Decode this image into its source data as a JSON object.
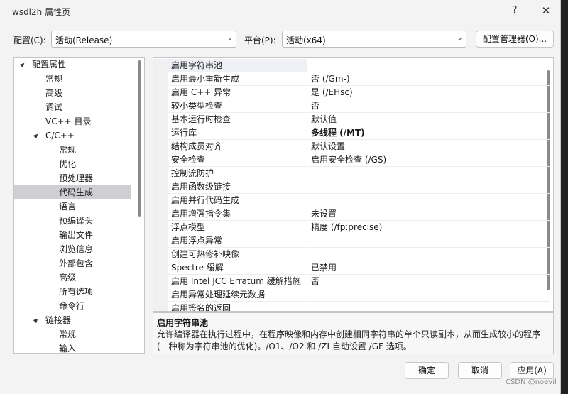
{
  "window": {
    "title": "wsdl2h 属性页",
    "help": "?",
    "close": "✕"
  },
  "top": {
    "config_label": "配置(C):",
    "config_value": "活动(Release)",
    "platform_label": "平台(P):",
    "platform_value": "活动(x64)",
    "manager_button": "配置管理器(O)..."
  },
  "tree": [
    {
      "label": "配置属性",
      "expander": "▲"
    },
    {
      "label": "常规"
    },
    {
      "label": "高级"
    },
    {
      "label": "调试"
    },
    {
      "label": "VC++ 目录"
    },
    {
      "label": "C/C++",
      "expander": "▲"
    },
    {
      "label": "常规"
    },
    {
      "label": "优化"
    },
    {
      "label": "预处理器"
    },
    {
      "label": "代码生成",
      "selected": true
    },
    {
      "label": "语言"
    },
    {
      "label": "预编译头"
    },
    {
      "label": "输出文件"
    },
    {
      "label": "浏览信息"
    },
    {
      "label": "外部包含"
    },
    {
      "label": "高级"
    },
    {
      "label": "所有选项"
    },
    {
      "label": "命令行"
    },
    {
      "label": "链接器",
      "expander": "▲"
    },
    {
      "label": "常规"
    },
    {
      "label": "输入"
    }
  ],
  "properties": [
    {
      "name": "启用字符串池",
      "value": "",
      "selected": true
    },
    {
      "name": "启用最小重新生成",
      "value": "否 (/Gm-)"
    },
    {
      "name": "启用 C++ 异常",
      "value": "是 (/EHsc)"
    },
    {
      "name": "较小类型检查",
      "value": "否"
    },
    {
      "name": "基本运行时检查",
      "value": "默认值"
    },
    {
      "name": "运行库",
      "value": "多线程 (/MT)",
      "bold": true
    },
    {
      "name": "结构成员对齐",
      "value": "默认设置"
    },
    {
      "name": "安全检查",
      "value": "启用安全检查 (/GS)"
    },
    {
      "name": "控制流防护",
      "value": ""
    },
    {
      "name": "启用函数级链接",
      "value": ""
    },
    {
      "name": "启用并行代码生成",
      "value": ""
    },
    {
      "name": "启用增强指令集",
      "value": "未设置"
    },
    {
      "name": "浮点模型",
      "value": "精度 (/fp:precise)"
    },
    {
      "name": "启用浮点异常",
      "value": ""
    },
    {
      "name": "创建可热修补映像",
      "value": ""
    },
    {
      "name": "Spectre 缓解",
      "value": "已禁用"
    },
    {
      "name": "启用 Intel JCC Erratum 缓解措施",
      "value": "否"
    },
    {
      "name": "启用异常处理延续元数据",
      "value": ""
    },
    {
      "name": "启用签名的返回",
      "value": ""
    }
  ],
  "description": {
    "title": "启用字符串池",
    "text": "允许编译器在执行过程中，在程序映像和内存中创建相同字符串的单个只读副本，从而生成较小的程序(一种称为字符串池的优化)。/O1、/O2 和 /ZI 自动设置 /GF 选项。"
  },
  "buttons": {
    "ok": "确定",
    "cancel": "取消",
    "apply": "应用(A)"
  },
  "watermark": "CSDN @noevil"
}
